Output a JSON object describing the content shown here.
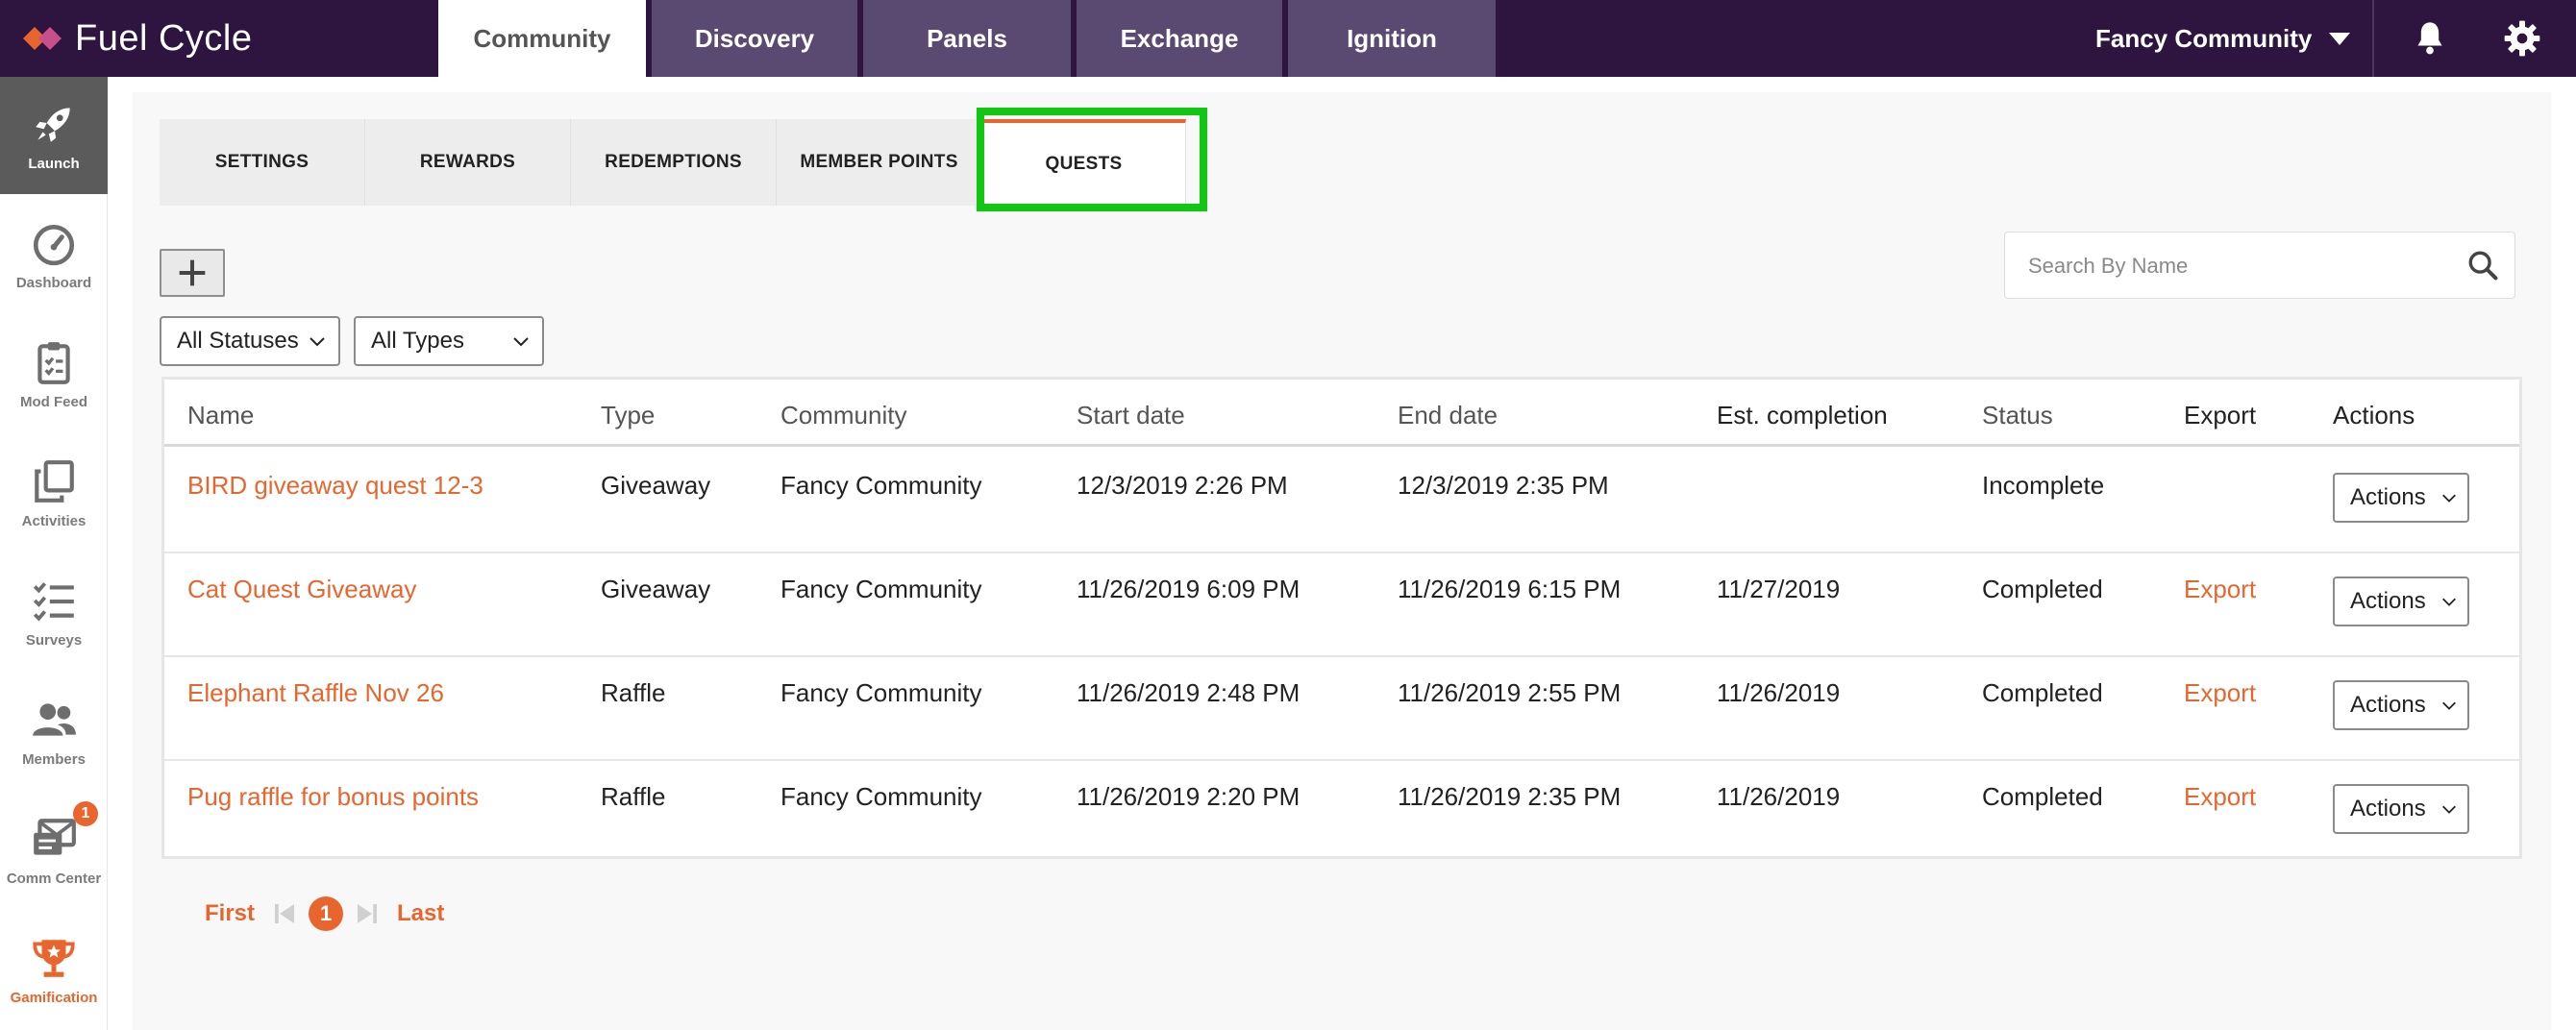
{
  "brand": {
    "name": "Fuel Cycle",
    "mark_colors": [
      "#e8662e",
      "#c94f8a"
    ]
  },
  "nav": {
    "tabs": [
      {
        "label": "Community",
        "active": true
      },
      {
        "label": "Discovery"
      },
      {
        "label": "Panels"
      },
      {
        "label": "Exchange"
      },
      {
        "label": "Ignition"
      }
    ],
    "community_selector": "Fancy Community",
    "icons": [
      "bell-icon",
      "gear-icon"
    ]
  },
  "sidebar": {
    "items": [
      {
        "label": "Launch",
        "icon": "rocket-icon",
        "active": true
      },
      {
        "label": "Dashboard",
        "icon": "gauge-icon"
      },
      {
        "label": "Mod Feed",
        "icon": "clipboard-icon"
      },
      {
        "label": "Activities",
        "icon": "copy-icon"
      },
      {
        "label": "Surveys",
        "icon": "checklist-icon"
      },
      {
        "label": "Members",
        "icon": "users-icon"
      },
      {
        "label": "Comm Center",
        "icon": "envelope-icon",
        "badge": "1"
      },
      {
        "label": "Gamification",
        "icon": "trophy-icon"
      }
    ]
  },
  "subtabs": [
    {
      "label": "SETTINGS"
    },
    {
      "label": "REWARDS"
    },
    {
      "label": "REDEMPTIONS"
    },
    {
      "label": "MEMBER POINTS"
    },
    {
      "label": "QUESTS",
      "active": true
    }
  ],
  "filters": {
    "status": "All Statuses",
    "type": "All Types"
  },
  "search": {
    "placeholder": "Search By Name",
    "value": ""
  },
  "table": {
    "headers": {
      "name": "Name",
      "type": "Type",
      "community": "Community",
      "start": "Start date",
      "end": "End date",
      "completion": "Est. completion",
      "status": "Status",
      "export": "Export",
      "actions": "Actions"
    },
    "rows": [
      {
        "name": "BIRD giveaway quest 12-3",
        "type": "Giveaway",
        "community": "Fancy Community",
        "start": "12/3/2019 2:26 PM",
        "end": "12/3/2019 2:35 PM",
        "completion": "",
        "status": "Incomplete",
        "export": "",
        "actions": "Actions"
      },
      {
        "name": "Cat Quest Giveaway",
        "type": "Giveaway",
        "community": "Fancy Community",
        "start": "11/26/2019 6:09 PM",
        "end": "11/26/2019 6:15 PM",
        "completion": "11/27/2019",
        "status": "Completed",
        "export": "Export",
        "actions": "Actions"
      },
      {
        "name": "Elephant Raffle Nov 26",
        "type": "Raffle",
        "community": "Fancy Community",
        "start": "11/26/2019 2:48 PM",
        "end": "11/26/2019 2:55 PM",
        "completion": "11/26/2019",
        "status": "Completed",
        "export": "Export",
        "actions": "Actions"
      },
      {
        "name": "Pug raffle for bonus points",
        "type": "Raffle",
        "community": "Fancy Community",
        "start": "11/26/2019 2:20 PM",
        "end": "11/26/2019 2:35 PM",
        "completion": "11/26/2019",
        "status": "Completed",
        "export": "Export",
        "actions": "Actions"
      }
    ]
  },
  "pagination": {
    "first": "First",
    "current": "1",
    "last": "Last"
  },
  "colors": {
    "accent": "#e8662e",
    "topbar": "#2d1540",
    "highlight": "#12c712"
  }
}
